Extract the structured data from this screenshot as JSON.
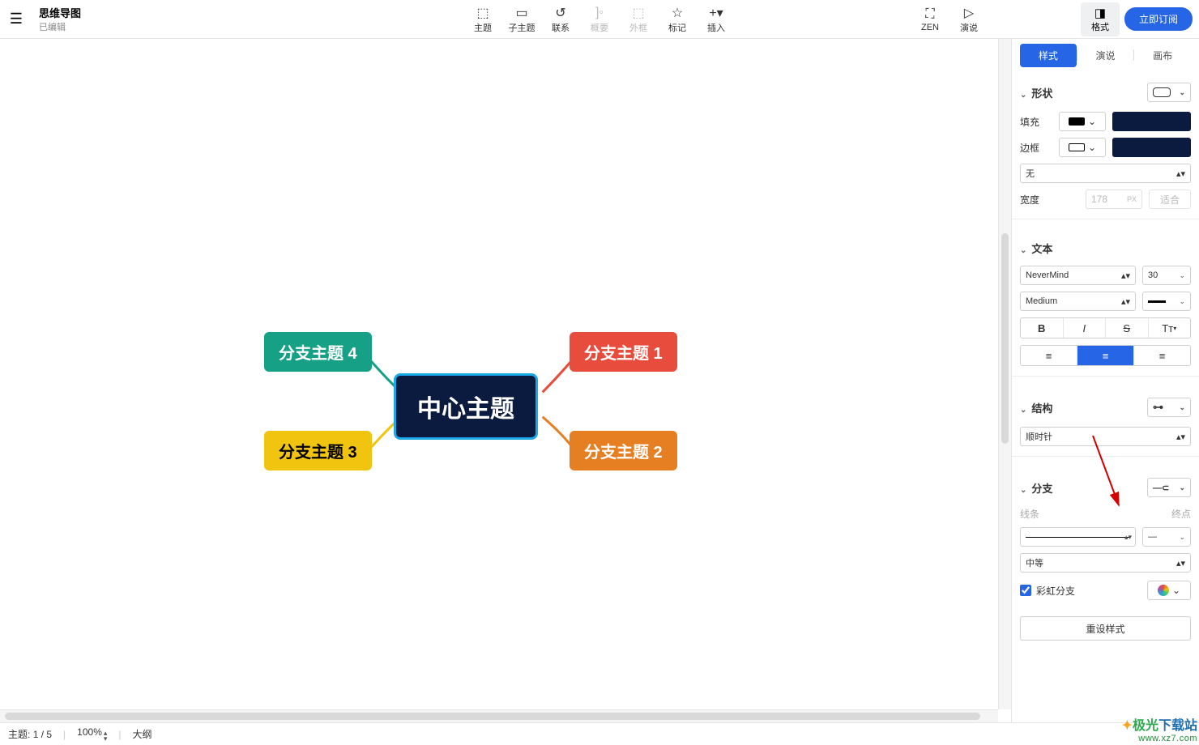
{
  "window": {
    "title": "思维导图",
    "subtitle": "已编辑",
    "win_min": "—",
    "win_max": "□",
    "win_close": "✕"
  },
  "toolbar": {
    "topic": "主题",
    "subtopic": "子主题",
    "relation": "联系",
    "summary": "概要",
    "boundary": "外框",
    "marker": "标记",
    "insert": "插入",
    "zen": "ZEN",
    "pitch": "演说",
    "format": "格式",
    "subscribe": "立即订阅"
  },
  "panel": {
    "tab_style": "样式",
    "tab_pitch": "演说",
    "tab_canvas": "画布",
    "shape_label": "形状",
    "fill_label": "填充",
    "border_label": "边框",
    "border_style_none": "无",
    "width_label": "宽度",
    "width_value": "178",
    "width_unit": "PX",
    "fit_label": "适合",
    "text_label": "文本",
    "font_family": "NeverMind",
    "font_size": "30",
    "font_weight": "Medium",
    "bold": "B",
    "italic": "I",
    "strike": "S",
    "textcase": "Tᴛ",
    "struct_label": "结构",
    "struct_dir": "顺时针",
    "branch_label": "分支",
    "line_label": "线条",
    "endpoint_label": "终点",
    "thickness": "中等",
    "rainbow_label": "彩虹分支",
    "reset": "重设样式",
    "fill_color": "#0b1b3f",
    "border_color": "#0b1b3f"
  },
  "mindmap": {
    "center": "中心主题",
    "b1": "分支主题 1",
    "b2": "分支主题 2",
    "b3": "分支主题 3",
    "b4": "分支主题 4"
  },
  "status": {
    "topic_label": "主题:",
    "topic_count": "1 / 5",
    "zoom": "100%",
    "outline": "大纲"
  },
  "watermark": {
    "line1a": "极光",
    "line1b": "下载站",
    "line2": "www.xz7.com"
  }
}
